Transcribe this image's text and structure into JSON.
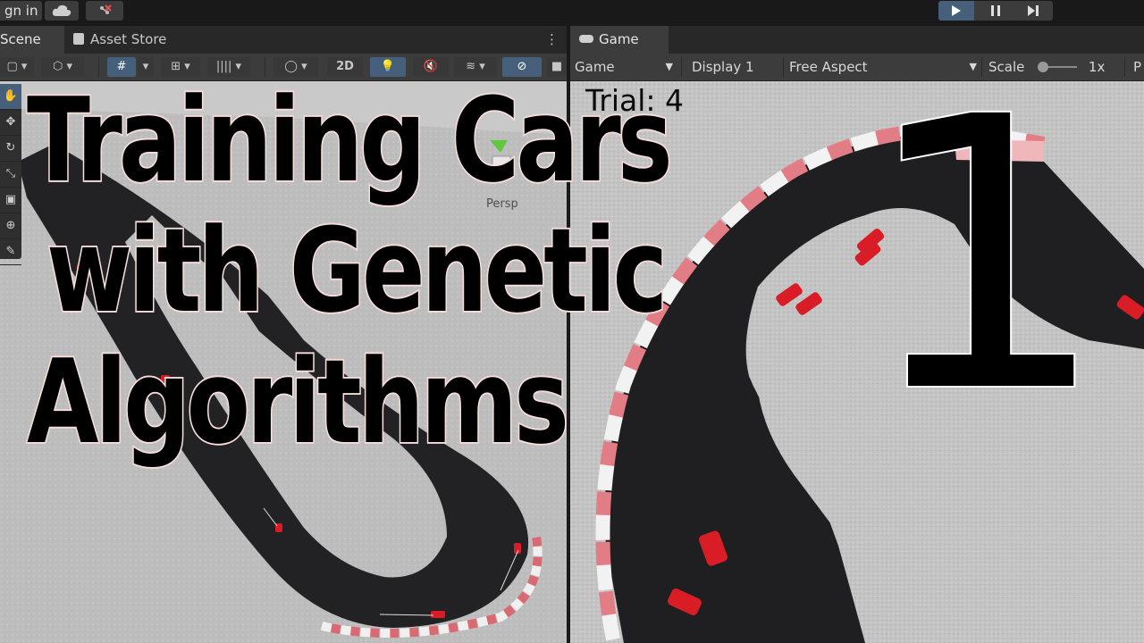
{
  "title_overlay": {
    "line1": "Training Cars",
    "line2": "with Genetic",
    "line3": "Algorithms",
    "episode": "1"
  },
  "topbar": {
    "sign_in_label": "gn in",
    "cloud_icon": "cloud-icon",
    "collab_icon": "collab-icon",
    "play_icon": "play-icon",
    "pause_icon": "pause-icon",
    "step_icon": "step-icon"
  },
  "scene_panel": {
    "tabs": [
      {
        "label": "Scene",
        "icon": "grid-icon"
      },
      {
        "label": "Asset Store",
        "icon": "shopping-bag-icon"
      }
    ],
    "toolbar": {
      "btn_2d": "2D",
      "axis_label": "y",
      "persp_label": "Persp"
    },
    "tools": [
      "hand-tool-icon",
      "move-tool-icon",
      "rotate-tool-icon",
      "scale-tool-icon",
      "rect-tool-icon",
      "transform-tool-icon"
    ]
  },
  "game_panel": {
    "tab_label": "Game",
    "toolbar": {
      "mode": "Game",
      "display": "Display 1",
      "aspect": "Free Aspect",
      "scale_label": "Scale",
      "scale_value": "1x",
      "extra": "P"
    },
    "trial_text": "Trial: 4"
  },
  "colors": {
    "editor_bg": "#191919",
    "panel_bar": "#3c3c3c",
    "active_blue": "#46607c",
    "track": "#1f1f21",
    "car_red": "#d81d27",
    "curb_red": "#e07a80"
  }
}
